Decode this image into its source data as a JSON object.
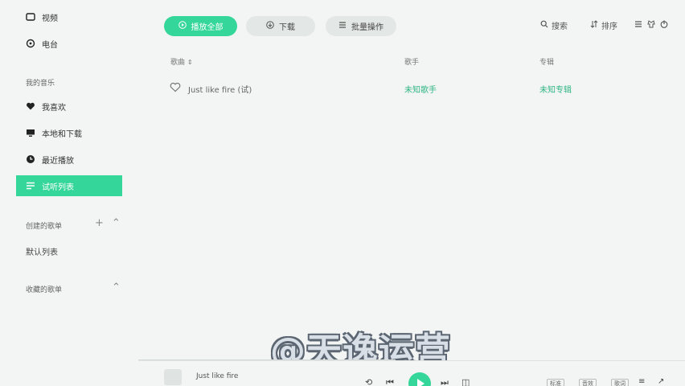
{
  "sidebar": {
    "top_items": [
      {
        "label": "视频",
        "icon": "video-icon"
      },
      {
        "label": "电台",
        "icon": "radio-icon"
      }
    ],
    "my_music_label": "我的音乐",
    "music_items": [
      {
        "label": "我喜欢",
        "icon": "heart-icon"
      },
      {
        "label": "本地和下载",
        "icon": "monitor-icon"
      },
      {
        "label": "最近播放",
        "icon": "clock-icon"
      },
      {
        "label": "试听列表",
        "icon": "list-icon"
      }
    ],
    "created_label": "创建的歌单",
    "default_list": "默认列表",
    "collected_label": "收藏的歌单"
  },
  "toolbar": {
    "play_all": "播放全部",
    "download": "下载",
    "batch": "批量操作",
    "right": [
      "搜索",
      "排序"
    ]
  },
  "table": {
    "columns": [
      "歌曲",
      "歌手",
      "专辑"
    ],
    "rows": [
      {
        "title": "Just like fire",
        "title_tag": "(试)",
        "artist": "未知歌手",
        "album": "未知专辑"
      }
    ]
  },
  "player": {
    "title": "Just like fire",
    "tags": [
      "标准",
      "音效",
      "歌词"
    ]
  },
  "watermark": "@天逸运营",
  "colors": {
    "accent": "#34d69a",
    "background": "#f3f5f4"
  }
}
